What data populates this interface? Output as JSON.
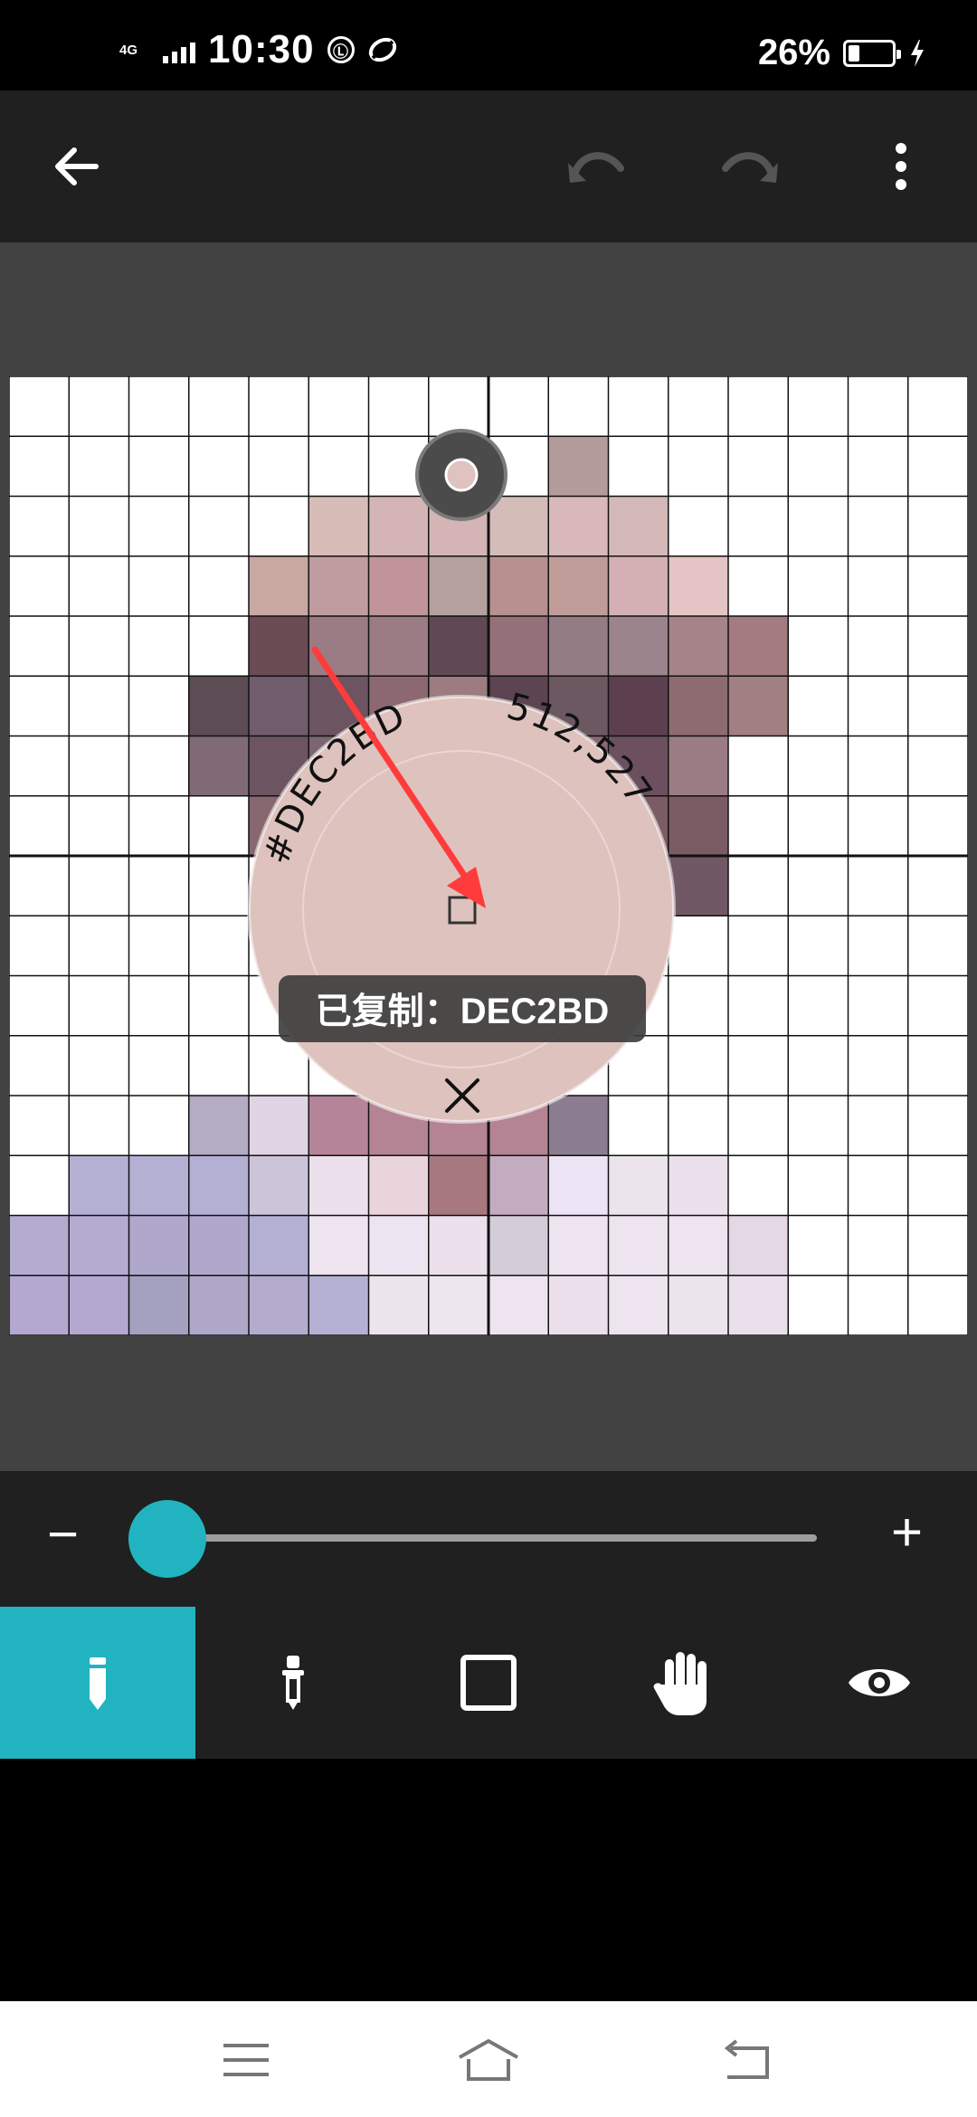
{
  "status_bar": {
    "network_type": "4G",
    "time": "10:30",
    "notification_icon_1": "Ⓛ",
    "battery_percent": "26%",
    "battery_level": 0.26
  },
  "toolbar": {
    "back_icon": "arrow-left",
    "undo_icon": "undo",
    "redo_icon": "redo",
    "menu_icon": "more-vertical"
  },
  "picker": {
    "hex": "#DEC2BD",
    "coords": "512,527",
    "toast": "已复制：DEC2BD",
    "close_icon": "close",
    "swatch_color": "#DEC2BD"
  },
  "brush_size": {
    "level": 0.02
  },
  "tools": [
    {
      "name": "pencil",
      "active": true
    },
    {
      "name": "eyedropper",
      "active": false
    },
    {
      "name": "square",
      "active": false
    },
    {
      "name": "hand",
      "active": false
    },
    {
      "name": "eye",
      "active": false
    }
  ],
  "colors": {
    "accent": "#21b4c0",
    "toolbar_bg": "#202020",
    "workspace_bg": "#424242"
  },
  "pixel_grid": {
    "columns": 16,
    "rows": 16,
    "default_color": "#FFFFFF",
    "cells": [
      [
        1,
        7,
        "#DCC0BD"
      ],
      [
        1,
        9,
        "#B49C9C"
      ],
      [
        2,
        5,
        "#D8BCB8"
      ],
      [
        2,
        6,
        "#D4B4B4"
      ],
      [
        2,
        7,
        "#D4B4B4"
      ],
      [
        2,
        8,
        "#D4BCB8"
      ],
      [
        2,
        9,
        "#D8B8B8"
      ],
      [
        2,
        10,
        "#D4B8B8"
      ],
      [
        3,
        4,
        "#C8A8A0"
      ],
      [
        3,
        5,
        "#C09CA0"
      ],
      [
        3,
        6,
        "#C09498"
      ],
      [
        3,
        7,
        "#B4A09C"
      ],
      [
        3,
        8,
        "#B89090"
      ],
      [
        3,
        9,
        "#C09C98"
      ],
      [
        3,
        10,
        "#D4B0B4"
      ],
      [
        3,
        11,
        "#E4C4C4"
      ],
      [
        4,
        4,
        "#6C4C54"
      ],
      [
        4,
        5,
        "#9C7C84"
      ],
      [
        4,
        6,
        "#9C7C84"
      ],
      [
        4,
        7,
        "#604854"
      ],
      [
        4,
        8,
        "#947078"
      ],
      [
        4,
        9,
        "#947C84"
      ],
      [
        4,
        10,
        "#9C848C"
      ],
      [
        4,
        11,
        "#A48488"
      ],
      [
        4,
        12,
        "#A47C80"
      ],
      [
        5,
        3,
        "#5C4C54"
      ],
      [
        5,
        4,
        "#705C6C"
      ],
      [
        5,
        5,
        "#6C5460"
      ],
      [
        5,
        6,
        "#8C6870"
      ],
      [
        5,
        7,
        "#9C7C80"
      ],
      [
        5,
        8,
        "#5C4450"
      ],
      [
        5,
        9,
        "#6C5860"
      ],
      [
        5,
        10,
        "#5C4050"
      ],
      [
        5,
        11,
        "#8C6C70"
      ],
      [
        5,
        12,
        "#A08080"
      ],
      [
        6,
        3,
        "#806A74"
      ],
      [
        6,
        4,
        "#6C5460"
      ],
      [
        6,
        5,
        "#7C6470"
      ],
      [
        6,
        6,
        "#A08088"
      ],
      [
        6,
        7,
        "#9C7C84"
      ],
      [
        6,
        8,
        "#8C6C74"
      ],
      [
        6,
        9,
        "#8C6874"
      ],
      [
        6,
        10,
        "#6C5060"
      ],
      [
        6,
        11,
        "#9C7C84"
      ],
      [
        7,
        4,
        "#886870"
      ],
      [
        7,
        5,
        "#9C7C84"
      ],
      [
        7,
        6,
        "#A88890"
      ],
      [
        7,
        7,
        "#A88890"
      ],
      [
        7,
        8,
        "#9C7C84"
      ],
      [
        7,
        9,
        "#8C6C74"
      ],
      [
        7,
        10,
        "#7C5C64"
      ],
      [
        7,
        11,
        "#7C5C64"
      ],
      [
        8,
        8,
        "#8C6C74"
      ],
      [
        8,
        9,
        "#8C6C74"
      ],
      [
        8,
        10,
        "#8C6C74"
      ],
      [
        8,
        11,
        "#705864"
      ],
      [
        12,
        3,
        "#B4ACC4"
      ],
      [
        12,
        4,
        "#E0D4E4"
      ],
      [
        12,
        5,
        "#B48498"
      ],
      [
        12,
        6,
        "#B48494"
      ],
      [
        12,
        7,
        "#B48494"
      ],
      [
        12,
        8,
        "#B48494"
      ],
      [
        12,
        9,
        "#8C7C90"
      ],
      [
        13,
        1,
        "#B4B0D4"
      ],
      [
        13,
        2,
        "#B4B0D4"
      ],
      [
        13,
        3,
        "#B4B0D4"
      ],
      [
        13,
        4,
        "#CCC4D8"
      ],
      [
        13,
        5,
        "#ECE0EC"
      ],
      [
        13,
        6,
        "#EAD4DC"
      ],
      [
        13,
        7,
        "#A87880"
      ],
      [
        13,
        8,
        "#C4ACC0"
      ],
      [
        13,
        9,
        "#ECE4F4"
      ],
      [
        13,
        10,
        "#ECE4EC"
      ],
      [
        13,
        11,
        "#ECE0EC"
      ],
      [
        14,
        0,
        "#B4ACD0"
      ],
      [
        14,
        1,
        "#B4ACD0"
      ],
      [
        14,
        2,
        "#B0A8CC"
      ],
      [
        14,
        3,
        "#B0A8CC"
      ],
      [
        14,
        4,
        "#B4B0D4"
      ],
      [
        14,
        5,
        "#EDE4F0"
      ],
      [
        14,
        6,
        "#ECE4F0"
      ],
      [
        14,
        7,
        "#ECE0EC"
      ],
      [
        14,
        8,
        "#D4CCD8"
      ],
      [
        14,
        9,
        "#EDE4F0"
      ],
      [
        14,
        10,
        "#EDE4F0"
      ],
      [
        14,
        11,
        "#EDE4F0"
      ],
      [
        14,
        12,
        "#E4D8E4"
      ],
      [
        15,
        0,
        "#B4A8D0"
      ],
      [
        15,
        1,
        "#B4A8D0"
      ],
      [
        15,
        2,
        "#A4A0C0"
      ],
      [
        15,
        3,
        "#B0A8C8"
      ],
      [
        15,
        4,
        "#B4ACCC"
      ],
      [
        15,
        5,
        "#B4B0D4"
      ],
      [
        15,
        6,
        "#ECE4EC"
      ],
      [
        15,
        7,
        "#EDE6EE"
      ],
      [
        15,
        8,
        "#EDE4F0"
      ],
      [
        15,
        9,
        "#ECE0EC"
      ],
      [
        15,
        10,
        "#EDE4F0"
      ],
      [
        15,
        11,
        "#ECE4EC"
      ],
      [
        15,
        12,
        "#EAE0EC"
      ]
    ]
  },
  "nav_bar": {
    "menu_icon": "menu",
    "home_icon": "home",
    "back_icon": "back"
  }
}
